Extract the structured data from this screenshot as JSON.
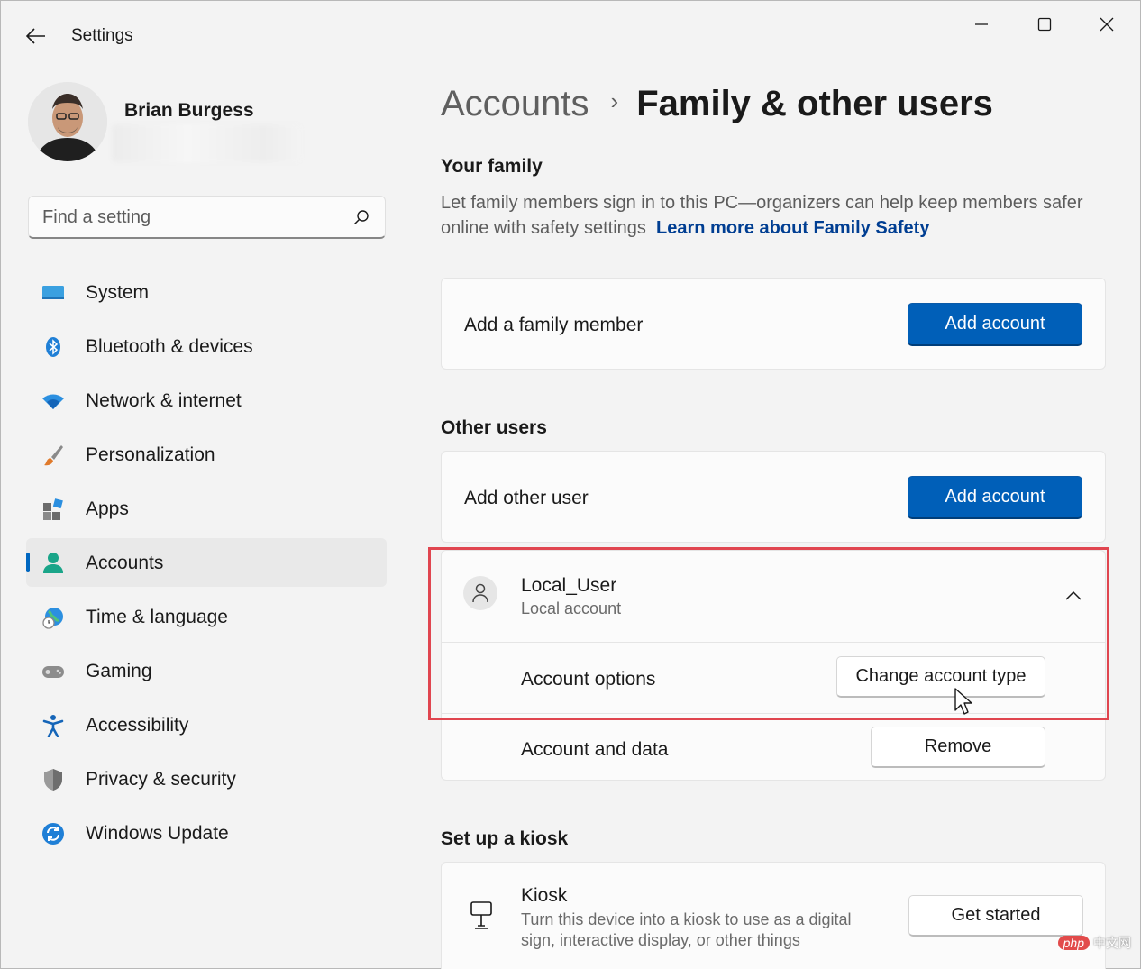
{
  "window": {
    "title": "Settings",
    "controls": [
      "minimize",
      "maximize",
      "close"
    ]
  },
  "profile": {
    "name": "Brian Burgess"
  },
  "search": {
    "placeholder": "Find a setting"
  },
  "sidebar": {
    "active": "Accounts",
    "items": [
      {
        "label": "System",
        "icon": "system-icon"
      },
      {
        "label": "Bluetooth & devices",
        "icon": "bluetooth-icon"
      },
      {
        "label": "Network & internet",
        "icon": "wifi-icon"
      },
      {
        "label": "Personalization",
        "icon": "brush-icon"
      },
      {
        "label": "Apps",
        "icon": "apps-icon"
      },
      {
        "label": "Accounts",
        "icon": "accounts-icon"
      },
      {
        "label": "Time & language",
        "icon": "globe-clock-icon"
      },
      {
        "label": "Gaming",
        "icon": "gamepad-icon"
      },
      {
        "label": "Accessibility",
        "icon": "accessibility-icon"
      },
      {
        "label": "Privacy & security",
        "icon": "shield-icon"
      },
      {
        "label": "Windows Update",
        "icon": "update-icon"
      }
    ]
  },
  "header": {
    "parent": "Accounts",
    "current": "Family & other users"
  },
  "family": {
    "title": "Your family",
    "description": "Let family members sign in to this PC—organizers can help keep members safer online with safety settings",
    "link": "Learn more about Family Safety",
    "row_label": "Add a family member",
    "button": "Add account"
  },
  "other_users": {
    "title": "Other users",
    "row_label": "Add other user",
    "button": "Add account",
    "user": {
      "name": "Local_User",
      "type": "Local account",
      "expanded": true,
      "options_label": "Account options",
      "options_button": "Change account type",
      "data_label": "Account and data",
      "data_button": "Remove"
    }
  },
  "kiosk": {
    "title": "Set up a kiosk",
    "name": "Kiosk",
    "description": "Turn this device into a kiosk to use as a digital sign, interactive display, or other things",
    "button": "Get started"
  },
  "watermark": {
    "badge": "php",
    "text": "中文网"
  },
  "colors": {
    "accent": "#005fb8",
    "highlight_border": "#e0454f",
    "link": "#003e92"
  }
}
